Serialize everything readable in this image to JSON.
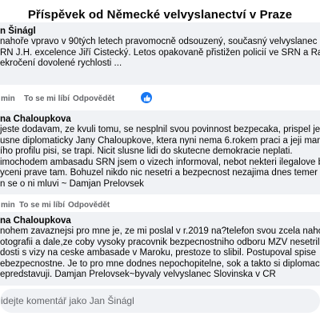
{
  "page_title": "Příspěvek od Německé velvyslanectví v Praze",
  "comments": [
    {
      "author": "n Šinágl",
      "lines": [
        "nahoře vpravo v 90tých letech pravomocně odsouzený, současný velvyslanec ČR ve",
        "RN J.H. excelence Jiří Čistecký. Letos opakovaně přistižen policií ve SRN a Rakousku",
        "ekročení dovolené rychlosti ..."
      ],
      "actions": {
        "time": "min",
        "like": "To se mi líbí",
        "reply": "Odpovědět"
      }
    },
    {
      "author": "na Chaloupkova",
      "lines": [
        "jeste dodavam, ze kvuli tomu, se nesplnil svou povinnost bezpecaka, prispel je zni",
        "usne diplomaticky Jany Chaloupkove, ktera nyni nema 6.rokem praci a jeji maminka",
        "ího profilu pisi, se trapi. Nicit slusne lidi do skutecne demokracie neplati.",
        "imochodem ambasadu SRN jsem o vizech informoval, nebot nekteri ilegalove byli",
        "yceni prave tam. Bohuzel nikdo nic nesetri a bezpecnost nezajima dnes temer niko",
        "n se o ni mluvi ~ Damjan Prelovsek"
      ],
      "actions": {
        "time": "min",
        "like": "To se mi líbí",
        "reply": "Odpovědět"
      }
    },
    {
      "author": "na Chaloupkova",
      "lines": [
        "nohem zavaznejsi pro mne je, ze mi poslal v r.2019 na?telefon svou zcela nahou",
        "otografii a dale,ze coby vysoky pracovnik bezpecnostniho odboru MZV nesetril",
        "dosti s vizy na ceske ambasade v Maroku, prestoze to slibil. Postupoval spise",
        "ebezpecnostne. Je to pro mne dodnes nepochopitelne, sok a takto si diplomacii v E",
        "epredstavuji. Damjan Prelovsek~byvaly velvyslanec Slovinska v CR"
      ]
    }
  ],
  "reply_placeholder": "idejte komentář jako Jan Šinágl",
  "colors": {
    "like_blue": "#1877f2",
    "bubble_bg": "#f0f2f5",
    "muted_text": "#65676b"
  }
}
